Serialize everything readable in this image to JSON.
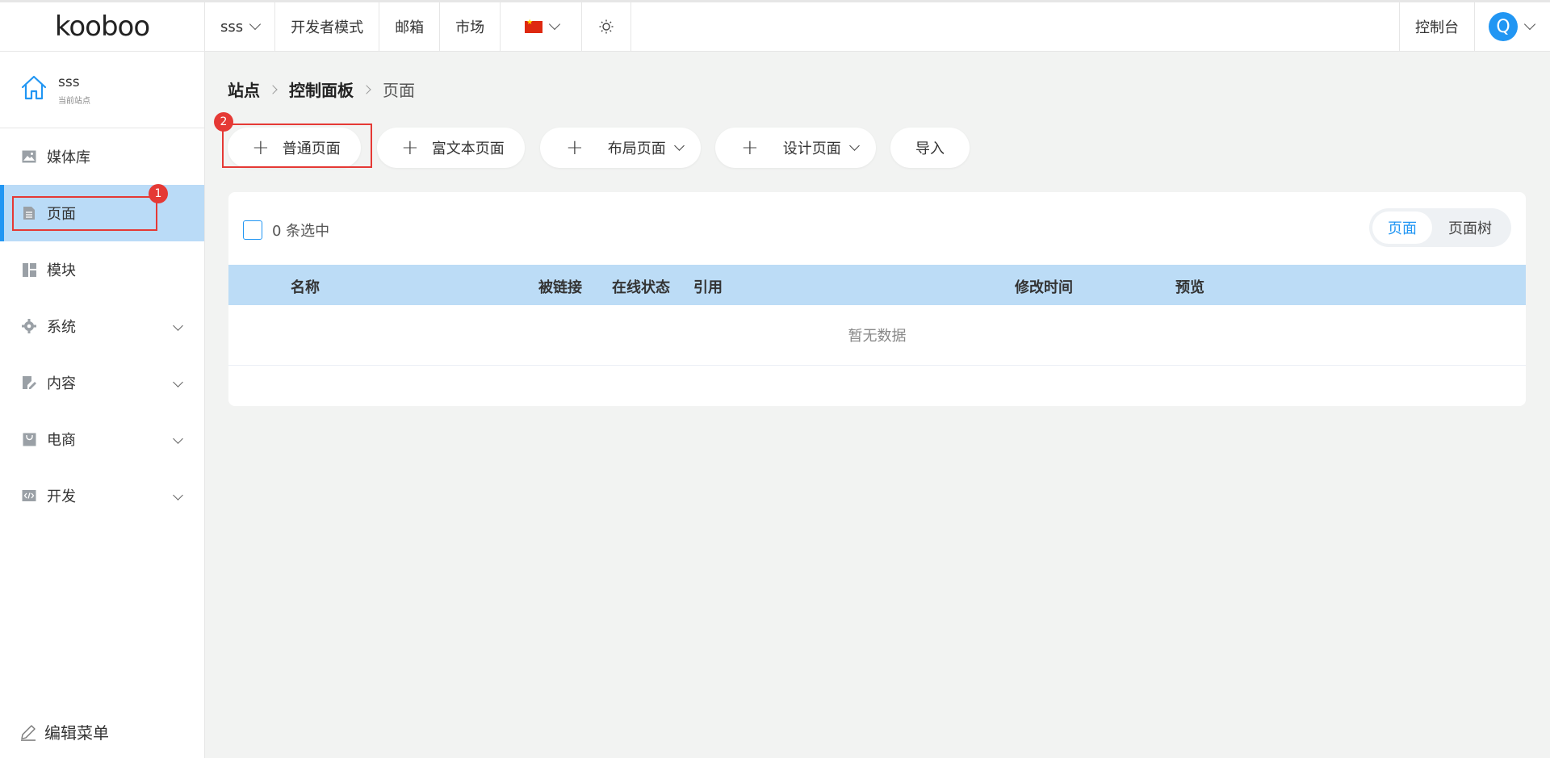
{
  "header": {
    "logo_text": "kooboo",
    "site_selector": "sss",
    "developer_mode": "开发者模式",
    "mailbox": "邮箱",
    "market": "市场",
    "console": "控制台",
    "avatar_letter": "Q"
  },
  "sidebar": {
    "site_name": "sss",
    "site_sub": "当前站点",
    "items": [
      {
        "label": "媒体库",
        "icon": "image-icon"
      },
      {
        "label": "页面",
        "icon": "document-icon"
      },
      {
        "label": "模块",
        "icon": "module-icon"
      },
      {
        "label": "系统",
        "icon": "gear-icon"
      },
      {
        "label": "内容",
        "icon": "edit-document-icon"
      },
      {
        "label": "电商",
        "icon": "shopping-bag-icon"
      },
      {
        "label": "开发",
        "icon": "code-icon"
      }
    ],
    "edit_menu": "编辑菜单",
    "badge_1": "1"
  },
  "breadcrumb": [
    "站点",
    "控制面板",
    "页面"
  ],
  "actions": {
    "normal_page": "普通页面",
    "rich_text_page": "富文本页面",
    "layout_page": "布局页面",
    "design_page": "设计页面",
    "import": "导入",
    "badge_2": "2"
  },
  "table": {
    "selected_text": "0 条选中",
    "view_toggle": [
      "页面",
      "页面树"
    ],
    "columns": [
      "名称",
      "被链接",
      "在线状态",
      "引用",
      "修改时间",
      "预览"
    ],
    "empty_text": "暂无数据"
  },
  "colors": {
    "accent": "#2196f3",
    "active_bg": "#badbf7",
    "table_header_bg": "#bcdcf6",
    "highlight_red": "#e53935"
  }
}
